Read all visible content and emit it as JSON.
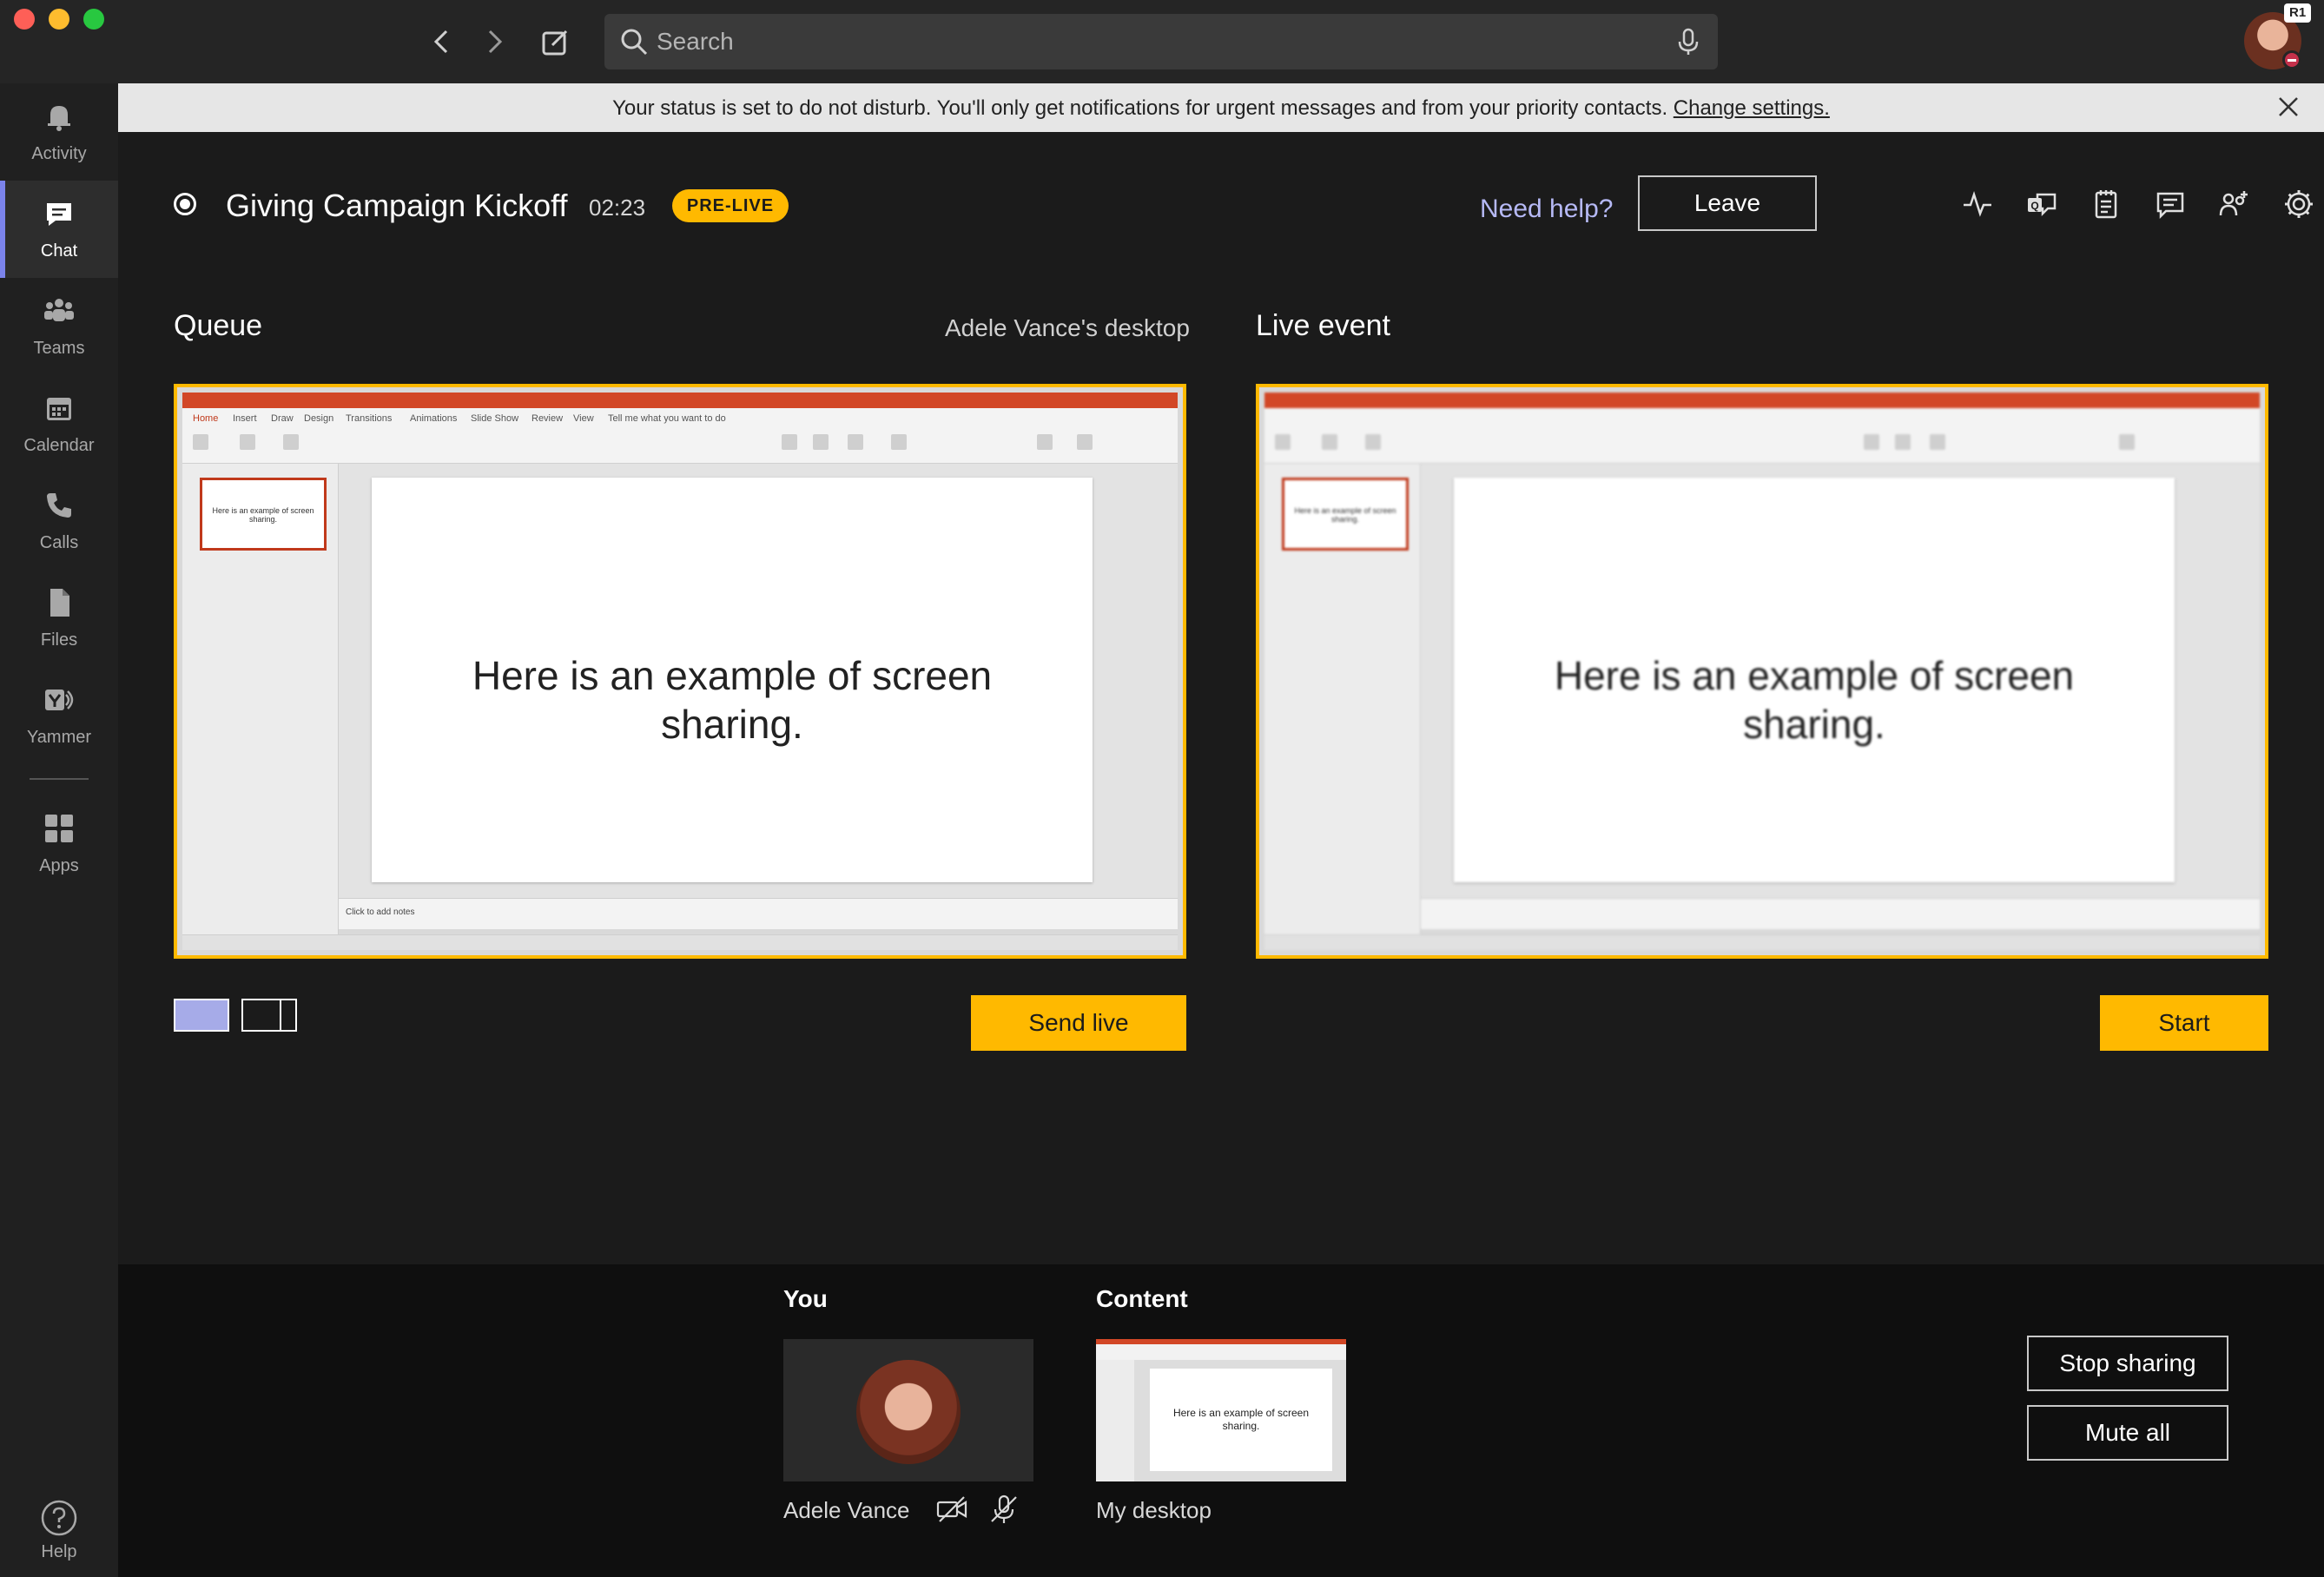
{
  "search": {
    "placeholder": "Search"
  },
  "user": {
    "badge": "R1"
  },
  "rail": {
    "items": [
      {
        "label": "Activity",
        "icon": "bell-icon"
      },
      {
        "label": "Chat",
        "icon": "chat-icon",
        "active": true
      },
      {
        "label": "Teams",
        "icon": "teams-icon"
      },
      {
        "label": "Calendar",
        "icon": "calendar-icon"
      },
      {
        "label": "Calls",
        "icon": "phone-icon"
      },
      {
        "label": "Files",
        "icon": "files-icon"
      },
      {
        "label": "Yammer",
        "icon": "yammer-icon"
      },
      {
        "label": "Apps",
        "icon": "apps-icon"
      }
    ],
    "help_label": "Help"
  },
  "banner": {
    "text": "Your status is set to do not disturb. You'll only get notifications for urgent messages and from your priority contacts. ",
    "link": "Change settings."
  },
  "event": {
    "title": "Giving Campaign Kickoff",
    "time": "02:23",
    "status": "PRE-LIVE",
    "need_help": "Need help?",
    "leave": "Leave"
  },
  "queue": {
    "label": "Queue",
    "source": "Adele Vance's desktop",
    "slide_text": "Here is an example of screen sharing.",
    "thumb_text": "Here is an example of screen sharing.",
    "notes_text": "Click to add notes",
    "send_live": "Send live"
  },
  "live": {
    "label": "Live event",
    "slide_text": "Here is an example of screen sharing.",
    "thumb_text": "Here is an example of screen sharing.",
    "start": "Start"
  },
  "ppt_tabs": [
    "Home",
    "Insert",
    "Draw",
    "Design",
    "Transitions",
    "Animations",
    "Slide Show",
    "Review",
    "View",
    "Tell me what you want to do"
  ],
  "bottom": {
    "you_label": "You",
    "you_name": "Adele Vance",
    "content_label": "Content",
    "content_caption": "My desktop",
    "content_slide_text": "Here is an example of screen sharing.",
    "stop_sharing": "Stop sharing",
    "mute_all": "Mute all"
  },
  "colors": {
    "accent": "#ffb900",
    "brand": "#7b83eb",
    "dnd": "#c4314b"
  }
}
